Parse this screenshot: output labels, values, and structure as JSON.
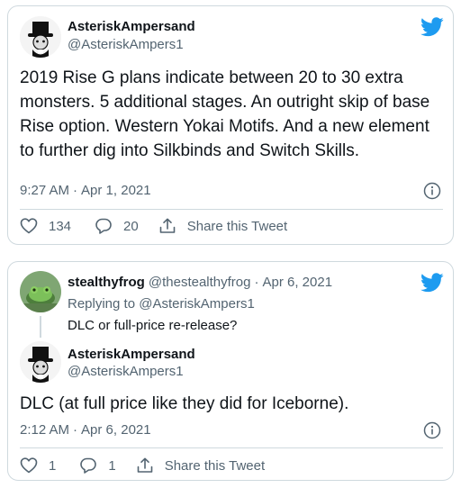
{
  "colors": {
    "brand": "#1d9bf0",
    "muted": "#536471",
    "border": "#cfd9de"
  },
  "tweet1": {
    "author": {
      "name": "AsteriskAmpersand",
      "handle": "@AsteriskAmpers1"
    },
    "text": "2019 Rise G plans indicate between 20 to 30 extra monsters. 5 additional stages. An outright skip of base Rise option. Western Yokai Motifs. And a new element to further dig into Silkbinds and Switch Skills.",
    "time": "9:27 AM",
    "separator": "·",
    "date": "Apr 1, 2021",
    "likes": "134",
    "replies": "20",
    "share_label": "Share this Tweet",
    "icons": [
      "twitter-bird-icon",
      "info-icon",
      "heart-icon",
      "reply-bubble-icon",
      "share-icon"
    ]
  },
  "tweet2": {
    "parent": {
      "name": "stealthyfrog",
      "handle": "@thestealthyfrog",
      "separator": "·",
      "date": "Apr 6, 2021",
      "replying_prefix": "Replying to",
      "replying_to": "@AsteriskAmpers1",
      "text": "DLC or full-price re-release?"
    },
    "reply": {
      "name": "AsteriskAmpersand",
      "handle": "@AsteriskAmpers1",
      "text": "DLC (at full price like they did for Iceborne).",
      "time": "2:12 AM",
      "separator": "·",
      "date": "Apr 6, 2021",
      "likes": "1",
      "replies": "1",
      "share_label": "Share this Tweet"
    }
  }
}
